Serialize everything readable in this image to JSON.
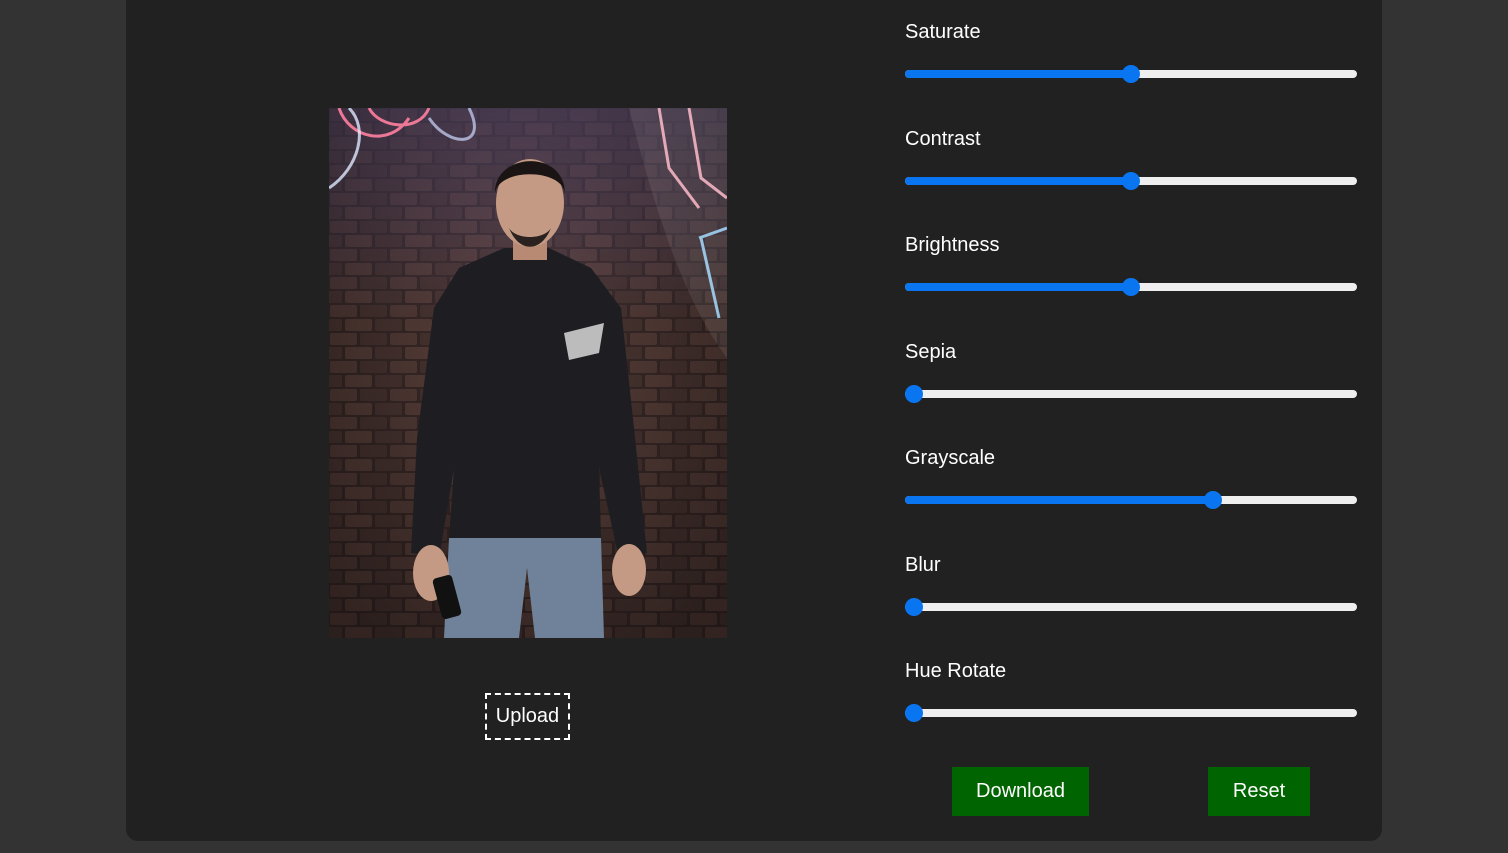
{
  "editor": {
    "upload_label": "Upload",
    "download_label": "Download",
    "reset_label": "Reset"
  },
  "filters": [
    {
      "label": "Saturate",
      "value": 0.5
    },
    {
      "label": "Contrast",
      "value": 0.5
    },
    {
      "label": "Brightness",
      "value": 0.5
    },
    {
      "label": "Sepia",
      "value": 0.0
    },
    {
      "label": "Grayscale",
      "value": 0.69
    },
    {
      "label": "Blur",
      "value": 0.0
    },
    {
      "label": "Hue Rotate",
      "value": 0.0
    }
  ],
  "colors": {
    "accent": "#0a75f0",
    "button": "#006400",
    "panel": "#212121",
    "background": "#333333"
  }
}
